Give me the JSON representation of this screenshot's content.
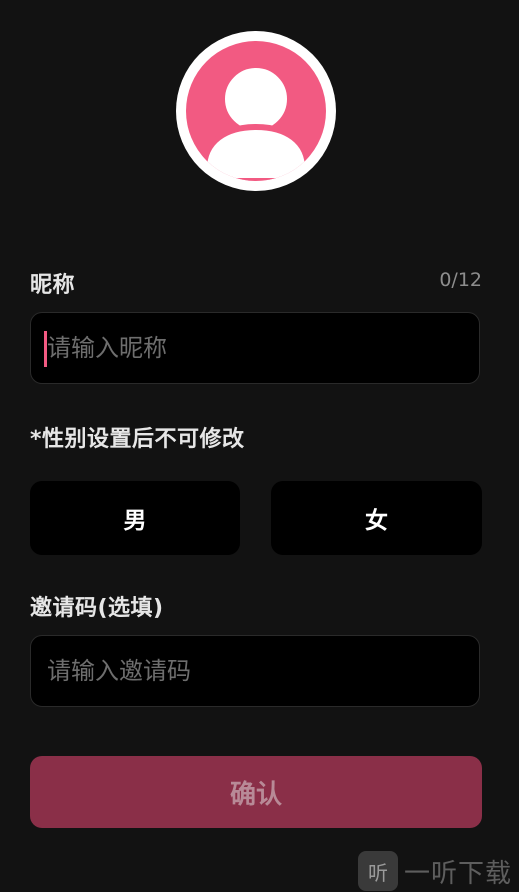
{
  "profile": {
    "avatar_icon": "user-silhouette-icon",
    "nickname_label": "昵称",
    "nickname_counter": "0/12",
    "nickname_placeholder": "请输入昵称",
    "nickname_value": ""
  },
  "gender": {
    "notice": "*性别设置后不可修改",
    "male_label": "男",
    "female_label": "女"
  },
  "invite": {
    "label": "邀请码(选填)",
    "placeholder": "请输入邀请码",
    "value": ""
  },
  "actions": {
    "confirm_label": "确认"
  },
  "watermark": {
    "badge": "听",
    "text": "一听下载"
  },
  "colors": {
    "background": "#121212",
    "accent": "#f25a82",
    "confirm_bg": "#8a2f48"
  }
}
